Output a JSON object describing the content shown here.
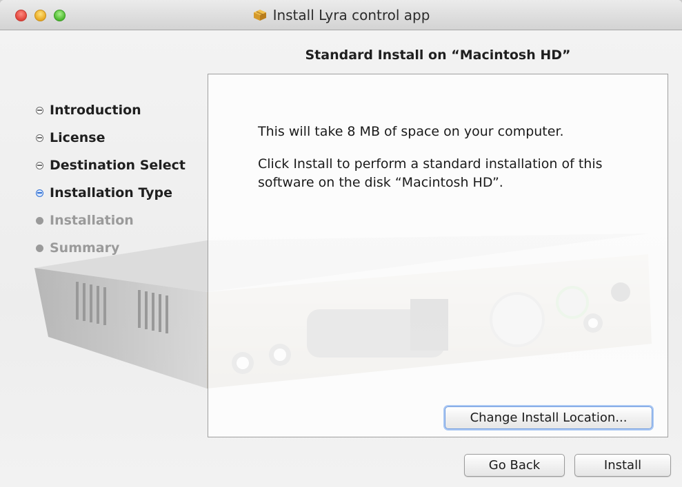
{
  "window": {
    "title": "Install Lyra control app"
  },
  "heading": "Standard Install on “Macintosh HD”",
  "steps": [
    {
      "label": "Introduction",
      "state": "done"
    },
    {
      "label": "License",
      "state": "done"
    },
    {
      "label": "Destination Select",
      "state": "done"
    },
    {
      "label": "Installation Type",
      "state": "current"
    },
    {
      "label": "Installation",
      "state": "pending"
    },
    {
      "label": "Summary",
      "state": "pending"
    }
  ],
  "content": {
    "line1": "This will take 8 MB of space on your computer.",
    "line2": "Click Install to perform a standard installation of this software on the disk “Macintosh HD”."
  },
  "buttons": {
    "change_location": "Change Install Location...",
    "go_back": "Go Back",
    "install": "Install"
  },
  "colors": {
    "current_step": "#2f6fd4",
    "pending_step": "#9a9a9a"
  }
}
